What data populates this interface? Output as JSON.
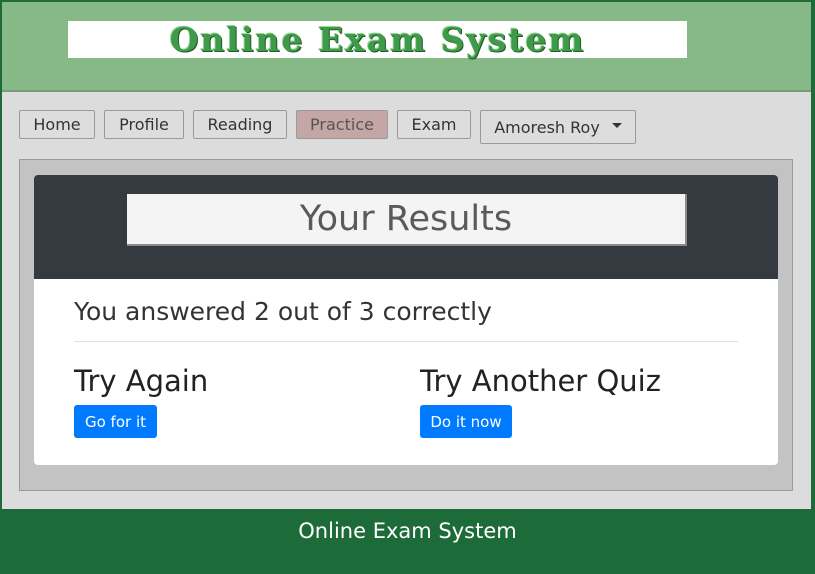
{
  "header": {
    "logo_text": "Online Exam System"
  },
  "nav": {
    "items": [
      {
        "label": "Home"
      },
      {
        "label": "Profile"
      },
      {
        "label": "Reading"
      },
      {
        "label": "Practice",
        "active": true
      },
      {
        "label": "Exam"
      }
    ],
    "user_menu": {
      "label": "Amoresh Roy"
    }
  },
  "results": {
    "title": "Your Results",
    "score_text": "You answered 2 out of 3 correctly",
    "try_again": {
      "heading": "Try Again",
      "button_label": "Go for it"
    },
    "another_quiz": {
      "heading": "Try Another Quiz",
      "button_label": "Do it now"
    }
  },
  "footer": {
    "text": "Online Exam System"
  },
  "colors": {
    "header_bg": "#86b986",
    "footer_bg": "#1e6b3a",
    "card_header_bg": "#343a40",
    "primary": "#007bff",
    "active_nav": "#c4a6a6"
  }
}
